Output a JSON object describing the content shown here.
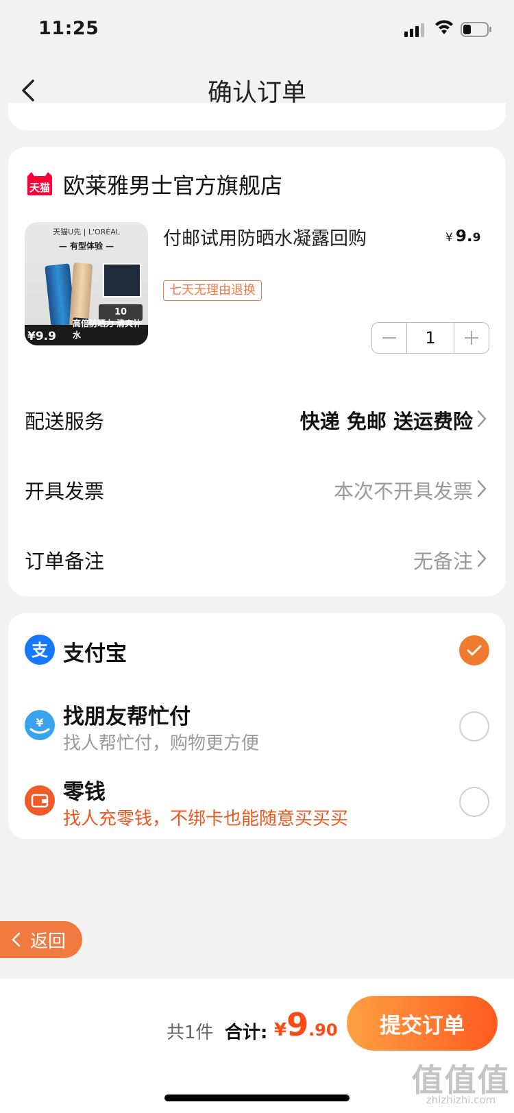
{
  "status_bar": {
    "time": "11:25"
  },
  "header": {
    "title": "确认订单"
  },
  "store": {
    "name": "欧莱雅男士官方旗舰店",
    "logo_text": "天猫"
  },
  "product": {
    "title": "付邮试用防晒水凝露回购",
    "price_currency": "¥",
    "price_int": "9.",
    "price_dec": "9",
    "return_tag": "七天无理由退换",
    "quantity": "1",
    "image": {
      "top_text": "天猫U先 | L'ORÉAL",
      "headline": "— 有型体验 —",
      "coupon": "10",
      "price": "¥9.9",
      "slogan": "高倍防晒力 清爽补水"
    }
  },
  "rows": [
    {
      "label": "配送服务",
      "value": "快递 免邮 送运费险"
    },
    {
      "label": "开具发票",
      "value": "本次不开具发票"
    },
    {
      "label": "订单备注",
      "value": "无备注"
    }
  ],
  "payment": [
    {
      "title": "支付宝",
      "selected": true
    },
    {
      "title": "找朋友帮忙付",
      "subtitle": "找人帮忙付，购物更方便",
      "selected": false
    },
    {
      "title": "零钱",
      "subtitle": "找人充零钱，不绑卡也能随意买买买",
      "selected": false
    }
  ],
  "float_return": {
    "label": "返回"
  },
  "footer": {
    "count_text": "共1件",
    "total_label": "合计:",
    "total_currency": "¥",
    "total_int": "9",
    "total_dec": ".90",
    "submit_label": "提交订单"
  },
  "watermark": {
    "big": "值值值",
    "small": "zhizhizhi.com"
  },
  "colors": {
    "accent": "#f07a2f",
    "price_red": "#ff4a13",
    "alipay_blue": "#1677ff",
    "background": "#f2f2f2"
  }
}
